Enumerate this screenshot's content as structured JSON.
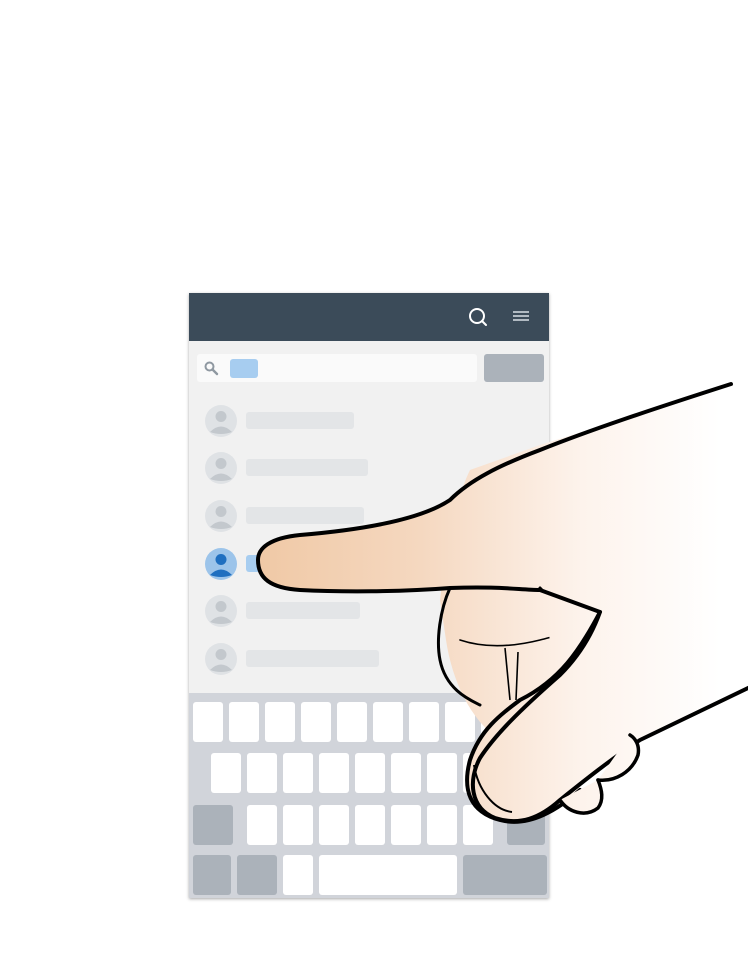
{
  "screen": {
    "search_button_label": "",
    "search_chip_label": "",
    "contacts": [
      {
        "name": ""
      },
      {
        "name": ""
      },
      {
        "name": ""
      },
      {
        "name": "",
        "selected": true
      },
      {
        "name": ""
      },
      {
        "name": ""
      }
    ]
  },
  "icons": {
    "topbar_search": "search-icon",
    "topbar_menu": "menu-icon",
    "search_field": "search-icon",
    "contact": "contact-avatar-icon",
    "gesture": "tap-gesture-hand"
  },
  "colors": {
    "topbar": "#3b4b59",
    "background": "#f1f1f1",
    "highlight": "#a7cdf0",
    "avatar_default": "#c3c8cd",
    "avatar_selected": "#4a8fd6",
    "keyboard": "#d1d4da",
    "key_function": "#abb2ba",
    "skin": "#f2d2b6"
  }
}
